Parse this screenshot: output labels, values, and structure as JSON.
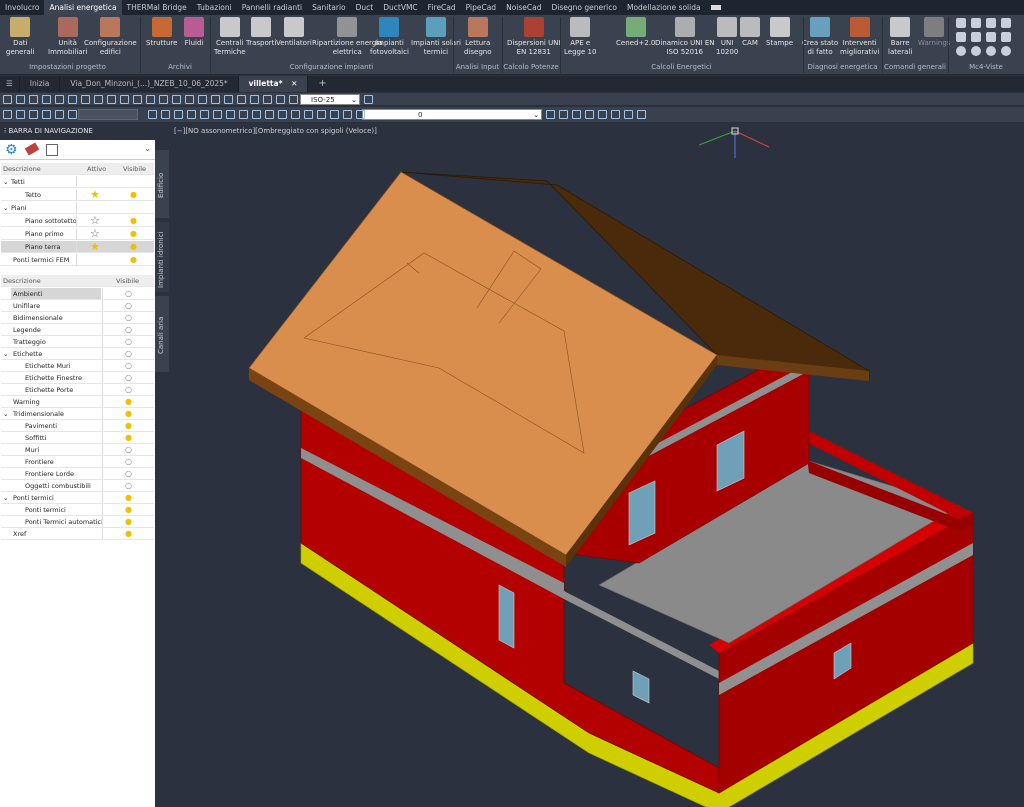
{
  "menu_tabs": [
    "Involucro",
    "Analisi energetica",
    "THERMal Bridge",
    "Tubazioni",
    "Pannelli radianti",
    "Sanitario",
    "Duct",
    "DuctVMC",
    "FireCad",
    "PipeCad",
    "NoiseCad",
    "Disegno generico",
    "Modellazione solida"
  ],
  "active_menu_tab": "Analisi energetica",
  "ribbon": {
    "buttons": [
      "Dati generali",
      "Unità Immobiliari",
      "Configurazione edifici",
      "Strutture",
      "Fluidi",
      "Centrali Termiche",
      "Trasporti",
      "Ventilatori",
      "Ripartizione energia elettrica",
      "Impianti fotovoltaici",
      "Impianti solari termici",
      "Lettura disegno",
      "Dispersioni UNI EN 12831",
      "APE e Legge 10",
      "Cened+2.0",
      "Dinamico UNI EN ISO 52016",
      "UNI 10200",
      "CAM",
      "Stampe",
      "Crea stato di fatto",
      "Interventi migliorativi",
      "Barre laterali",
      "Warnings"
    ],
    "groups": [
      "Impostazioni progetto",
      "Archivi",
      "Configurazione impianti",
      "Analisi Input",
      "Calcolo Potenze",
      "Calcoli Energetici",
      "Diagnosi energetica",
      "Comandi generali",
      "Mc4-Viste"
    ]
  },
  "file_tabs": [
    "Inizia",
    "Via_Don_Minzoni_(...)_NZEB_10_06_2025*",
    "villetta*"
  ],
  "active_file": "villetta*",
  "view_select": "ISO-25",
  "layer_select": "0",
  "panel": {
    "title": "BARRA DI NAVIGAZIONE",
    "top_headers": [
      "Descrizione",
      "Attivo",
      "Visibile"
    ],
    "top_rows": [
      {
        "label": "Tetti",
        "level": 0,
        "group": true,
        "active": "",
        "visible": false
      },
      {
        "label": "Tetto",
        "level": 1,
        "group": false,
        "active": "star-filled",
        "visible": true
      },
      {
        "label": "Piani",
        "level": 0,
        "group": true,
        "active": "",
        "visible": false
      },
      {
        "label": "Piano sottotetto",
        "level": 1,
        "group": false,
        "active": "star-empty",
        "visible": true
      },
      {
        "label": "Piano primo",
        "level": 1,
        "group": false,
        "active": "star-empty",
        "visible": true
      },
      {
        "label": "Piano terra",
        "level": 1,
        "group": false,
        "active": "star-filled",
        "visible": true,
        "selected": true
      },
      {
        "label": "Ponti termici FEM",
        "level": 0,
        "group": false,
        "active": "",
        "visible": true
      }
    ],
    "bottom_headers": [
      "Descrizione",
      "Visibile"
    ],
    "bottom_rows": [
      {
        "label": "Ambienti",
        "level": 0,
        "on": false,
        "selected": true
      },
      {
        "label": "Unifilare",
        "level": 0,
        "on": false
      },
      {
        "label": "Bidimensionale",
        "level": 0,
        "on": false
      },
      {
        "label": "Legende",
        "level": 0,
        "on": false
      },
      {
        "label": "Tratteggio",
        "level": 0,
        "on": false
      },
      {
        "label": "Etichette",
        "level": 0,
        "on": false,
        "group": true
      },
      {
        "label": "Etichette Muri",
        "level": 1,
        "on": false
      },
      {
        "label": "Etichette Finestre",
        "level": 1,
        "on": false
      },
      {
        "label": "Etichette Porte",
        "level": 1,
        "on": false
      },
      {
        "label": "Warning",
        "level": 0,
        "on": true
      },
      {
        "label": "Tridimensionale",
        "level": 0,
        "on": true,
        "group": true
      },
      {
        "label": "Pavimenti",
        "level": 1,
        "on": true
      },
      {
        "label": "Soffitti",
        "level": 1,
        "on": true
      },
      {
        "label": "Muri",
        "level": 1,
        "on": false
      },
      {
        "label": "Frontiere",
        "level": 1,
        "on": false
      },
      {
        "label": "Frontiere Lorde",
        "level": 1,
        "on": false
      },
      {
        "label": "Oggetti combustibili",
        "level": 1,
        "on": false
      },
      {
        "label": "Ponti termici",
        "level": 0,
        "on": true,
        "group": true
      },
      {
        "label": "Ponti termici",
        "level": 1,
        "on": true
      },
      {
        "label": "Ponti Termici automatici",
        "level": 1,
        "on": true
      },
      {
        "label": "Xref",
        "level": 0,
        "on": true
      }
    ],
    "side_tabs": [
      "Edificio",
      "Impianti idronici",
      "Canali aria"
    ]
  },
  "viewport_title": "[−][NO assonometrico][Ombreggiato con spigoli (Veloce)]",
  "colors": {
    "wall": "#b80000",
    "roof": "#d98e4e",
    "roof_dark": "#4a2a0a",
    "base": "#d8d800",
    "band": "#8f8f8f",
    "floor": "#8c8c8c",
    "window": "#6fa0b8",
    "bg": "#2b313e"
  }
}
